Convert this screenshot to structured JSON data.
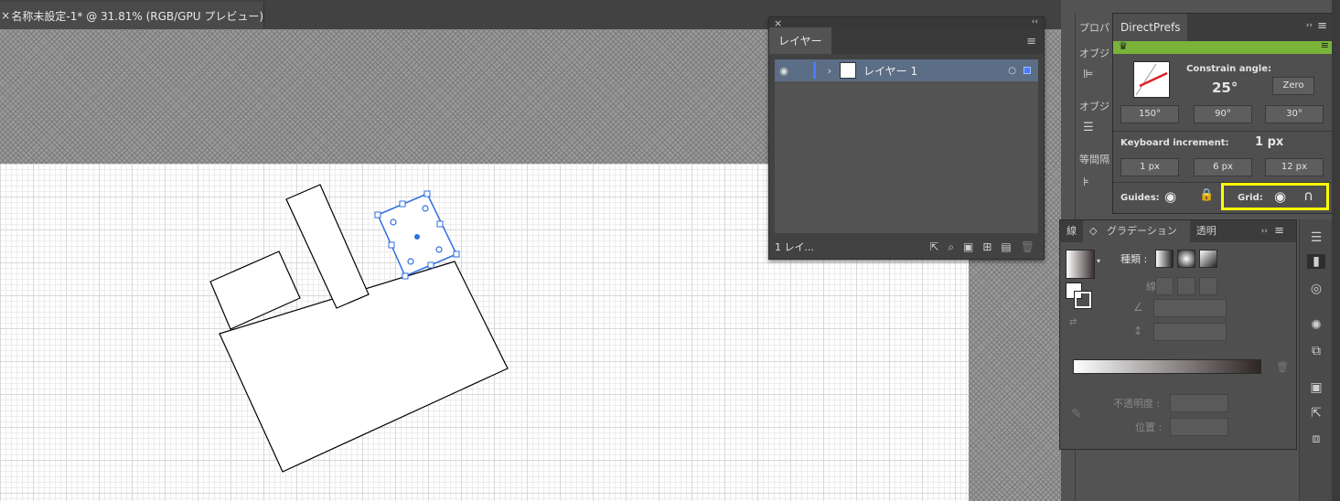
{
  "document_tab": {
    "close": "×",
    "title": "名称未設定-1* @ 31.81% (RGB/GPU プレビュー)"
  },
  "layers_panel": {
    "close": "×",
    "collapse": "‹‹",
    "tab": "レイヤー",
    "layer_name": "レイヤー 1",
    "footer_count": "1 レイ..."
  },
  "properties_panel": {
    "section1": "オブジ",
    "section2": "オブジ",
    "section3": "等間隔",
    "tab": "プロパ"
  },
  "direct_prefs": {
    "title": "DirectPrefs",
    "constrain_label": "Constrain angle:",
    "constrain_value": "25°",
    "zero_btn": "Zero",
    "angles": [
      "150°",
      "90°",
      "30°"
    ],
    "keyboard_label": "Keyboard increment:",
    "keyboard_value": "1 px",
    "increments": [
      "1 px",
      "6 px",
      "12 px"
    ],
    "guides_label": "Guides:",
    "grid_label": "Grid:"
  },
  "gradient_panel": {
    "tabs": [
      "線",
      "グラデーション",
      "透明"
    ],
    "type_label": "種類 :",
    "stroke_label": "線 :",
    "opacity_label": "不透明度 :",
    "location_label": "位置 :"
  },
  "colors": {
    "highlight": "#ffff00",
    "selection": "#2f6fe0",
    "accent_green": "#79b33a"
  }
}
